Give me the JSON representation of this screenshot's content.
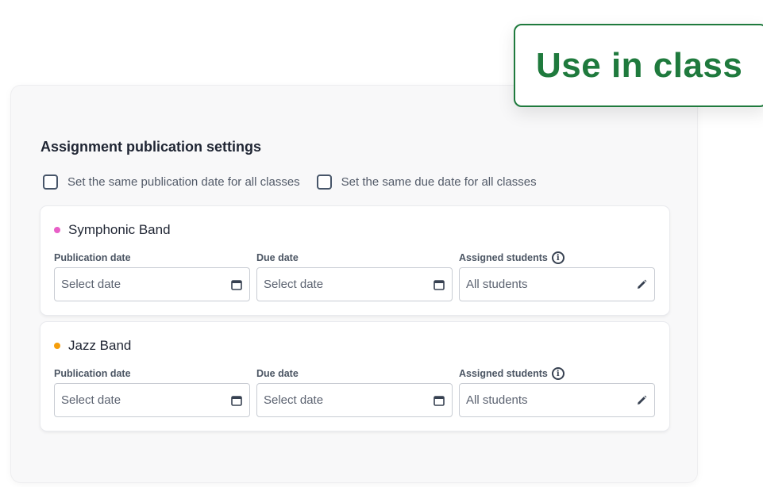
{
  "use_in_class_button": {
    "label": "Use in class"
  },
  "settings": {
    "title": "Assignment publication settings",
    "same_publication_date_label": "Set the same publication date for all classes",
    "same_due_date_label": "Set the same due date for all classes"
  },
  "classes": [
    {
      "name": "Symphonic Band",
      "dot_color": "#e85fc7",
      "publication_date_label": "Publication date",
      "publication_date_placeholder": "Select date",
      "due_date_label": "Due date",
      "due_date_placeholder": "Select date",
      "assigned_students_label": "Assigned students",
      "assigned_students_value": "All students"
    },
    {
      "name": "Jazz Band",
      "dot_color": "#f59e0b",
      "publication_date_label": "Publication date",
      "publication_date_placeholder": "Select date",
      "due_date_label": "Due date",
      "due_date_placeholder": "Select date",
      "assigned_students_label": "Assigned students",
      "assigned_students_value": "All students"
    }
  ],
  "icons": {
    "info": "info-icon",
    "calendar": "calendar-icon",
    "edit": "pencil-icon"
  },
  "colors": {
    "accent_green": "#1f7a3d"
  }
}
